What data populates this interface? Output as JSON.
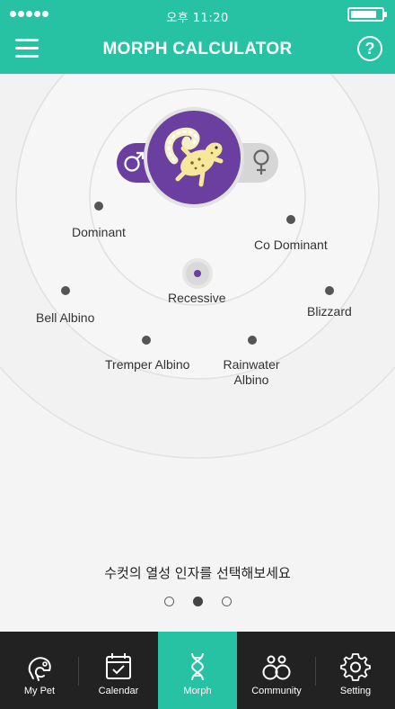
{
  "status_bar": {
    "time": "오후 11:20",
    "signal_bars": 5,
    "battery_level": 0.85
  },
  "header": {
    "title": "MORPH CALCULATOR",
    "menu_icon": "hamburger-menu-icon",
    "help_icon": "question-circle-icon",
    "help_glyph": "?"
  },
  "parent_selector": {
    "male_symbol": "♂",
    "female_symbol": "♀",
    "selected": "male",
    "image": "leopard-gecko-illustration"
  },
  "genes": {
    "dominant": "Dominant",
    "co_dominant": "Co Dominant",
    "recessive": "Recessive",
    "bell_albino": "Bell Albino",
    "blizzard": "Blizzard",
    "tremper_albino": "Tremper Albino",
    "rainwater_albino_line1": "Rainwater",
    "rainwater_albino_line2": "Albino",
    "selected": "Recessive"
  },
  "instruction": "수컷의 열성 인자를 선택해보세요",
  "pager": {
    "pages": 3,
    "current": 2
  },
  "tabs": [
    {
      "label": "My Pet",
      "icon": "chameleon-icon",
      "active": false
    },
    {
      "label": "Calendar",
      "icon": "calendar-check-icon",
      "active": false
    },
    {
      "label": "Morph",
      "icon": "dna-icon",
      "active": true
    },
    {
      "label": "Community",
      "icon": "community-icon",
      "active": false
    },
    {
      "label": "Setting",
      "icon": "gear-icon",
      "active": false
    }
  ],
  "colors": {
    "primary": "#27c2a3",
    "accent_purple": "#6b3fa0",
    "background": "#f4f4f4",
    "tabbar": "#222222"
  }
}
